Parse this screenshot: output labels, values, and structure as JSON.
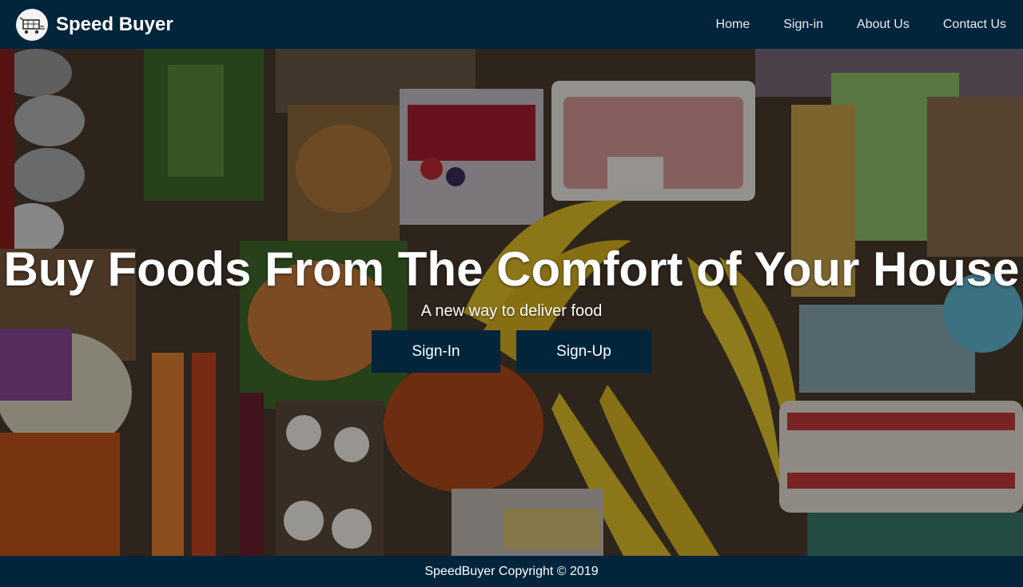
{
  "brand": {
    "name": "Speed Buyer",
    "logo_icon": "cart-icon"
  },
  "nav": {
    "items": [
      {
        "label": "Home"
      },
      {
        "label": "Sign-in"
      },
      {
        "label": "About Us"
      },
      {
        "label": "Contact Us"
      }
    ]
  },
  "hero": {
    "title": "Buy Foods From The Comfort of Your House",
    "subtitle": "A new way to deliver food",
    "signin_label": "Sign-In",
    "signup_label": "Sign-Up",
    "background": "groceries-photo"
  },
  "footer": {
    "text": "SpeedBuyer Copyright © 2019"
  },
  "colors": {
    "navbar": "#02253c",
    "button": "#02253c",
    "text": "#ffffff"
  }
}
